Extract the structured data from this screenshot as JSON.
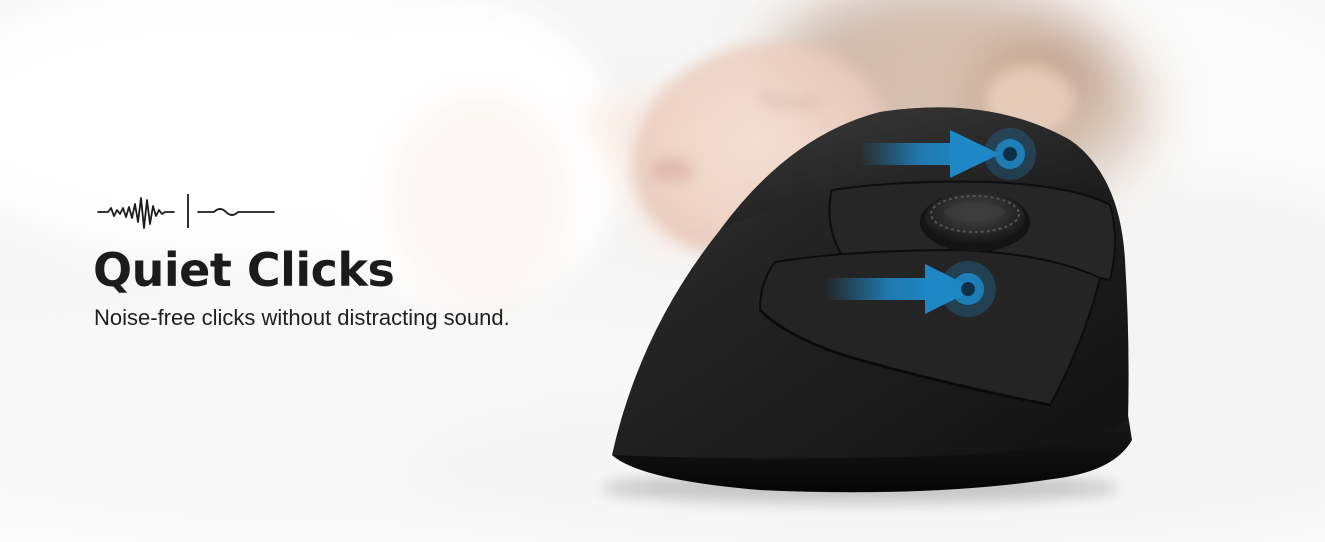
{
  "banner": {
    "headline": "Quiet Clicks",
    "subline": "Noise-free clicks without distracting sound.",
    "icons": {
      "feature_icon": "sound-wave-to-quiet-icon",
      "click_indicators": [
        "arrow-pointing-to-left-button",
        "arrow-pointing-to-right-button"
      ]
    },
    "colors": {
      "headline": "#1b1b1b",
      "arrow_accent": "#1e88c7",
      "mouse_body": "#1c1c1c"
    }
  }
}
